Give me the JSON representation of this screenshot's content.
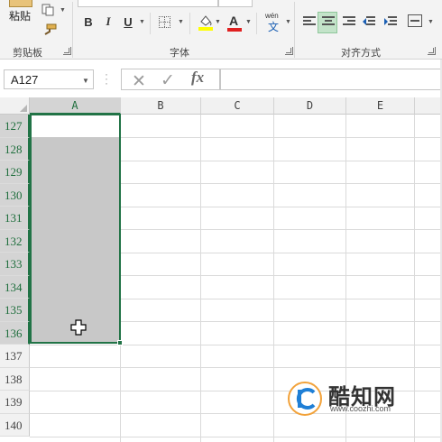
{
  "ribbon": {
    "paste_label": "粘贴",
    "clipboard_group": "剪贴板",
    "font_group": "字体",
    "alignment_group": "对齐方式",
    "bold_label": "B",
    "italic_label": "I",
    "underline_label": "U",
    "font_color_label": "A",
    "wen_top": "wén",
    "wen_char": "文",
    "icons": [
      "paste-icon",
      "copy-icon",
      "format-painter-icon",
      "border-icon",
      "fill-color-icon",
      "font-color-icon",
      "phonetic-guide-icon",
      "align-left-icon",
      "align-center-icon",
      "align-right-icon",
      "decrease-indent-icon",
      "increase-indent-icon",
      "merge-center-icon"
    ]
  },
  "formula_bar": {
    "name_box": "A127",
    "cancel_symbol": "✕",
    "enter_symbol": "✓",
    "fx_label": "fx",
    "formula": ""
  },
  "sheet": {
    "columns": [
      "A",
      "B",
      "C",
      "D",
      "E"
    ],
    "selected_column": "A",
    "rows": [
      "127",
      "128",
      "129",
      "130",
      "131",
      "132",
      "133",
      "134",
      "135",
      "136",
      "137",
      "138",
      "139",
      "140"
    ],
    "selected_rows": [
      "127",
      "128",
      "129",
      "130",
      "131",
      "132",
      "133",
      "134",
      "135",
      "136"
    ],
    "active_cell": "A127",
    "selection_range": "A127:A136"
  },
  "colors": {
    "accent_green": "#217346",
    "selection_fill": "#c8c8c8",
    "fill_color_bar": "#ffff00",
    "font_color_bar": "#e02020"
  },
  "watermark": {
    "text": "酷知网",
    "url": "www.coozhi.com"
  }
}
